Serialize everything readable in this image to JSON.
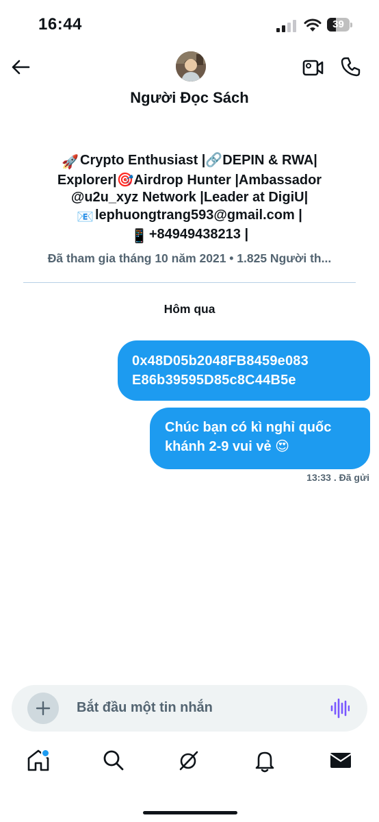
{
  "status_bar": {
    "time": "16:44",
    "battery": "39",
    "battery_level": 0.39
  },
  "header": {
    "name": "Người Đọc Sách",
    "back_icon": "arrow-left-icon",
    "video_icon": "video-camera-icon",
    "call_icon": "phone-icon"
  },
  "profile": {
    "bio_lines": [
      {
        "emoji": "🚀",
        "text": "Crypto Enthusiast |🔗DEPIN & RWA|"
      },
      {
        "emoji": "",
        "text": "Explorer|🎯Airdrop Hunter |Ambassador"
      },
      {
        "emoji": "",
        "text": "@u2u_xyz Network |Leader at DigiU|"
      },
      {
        "emoji": "📧",
        "text": "lephuongtrang593@gmail.com |"
      },
      {
        "emoji": "📱",
        "text": "+84949438213 |"
      }
    ],
    "joined": "Đã tham gia tháng 10 năm 2021 • 1.825 Người th..."
  },
  "conversation": {
    "day_label": "Hôm qua",
    "messages": [
      {
        "lines": [
          "0x48D05b2048FB8459e083",
          "E86b39595D85c8C44B5e"
        ]
      },
      {
        "lines": [
          "Chúc bạn có kì nghỉ quốc",
          "khánh 2-9 vui vẻ 😍"
        ]
      }
    ],
    "meta": "13:33 . Đã gửi"
  },
  "composer": {
    "placeholder": "Bắt đầu một tin nhắn",
    "add_icon": "plus-icon",
    "voice_icon": "voice-waveform-icon"
  },
  "tab_bar": {
    "tabs": [
      {
        "icon": "home-icon",
        "active": true
      },
      {
        "icon": "search-icon"
      },
      {
        "icon": "grok-icon"
      },
      {
        "icon": "bell-icon"
      },
      {
        "icon": "envelope-icon",
        "active": true
      }
    ]
  },
  "colors": {
    "accent": "#1d9bf0",
    "text": "#0f1419",
    "secondary": "#536471"
  }
}
